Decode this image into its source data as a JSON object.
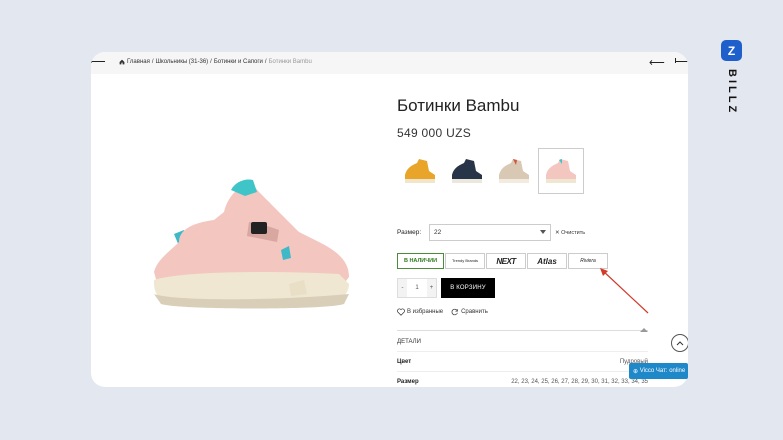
{
  "breadcrumb": {
    "home": "Главная",
    "sep": "/",
    "level1": "Школьникы (31-36)",
    "level2": "Ботинки и Сапоги",
    "current": "Ботинки Bambu"
  },
  "product": {
    "title": "Ботинки Bambu",
    "price": "549 000 UZS"
  },
  "size": {
    "label": "Размер:",
    "value": "22",
    "clear": "Очистить"
  },
  "stores": {
    "in_stock": "В НАЛИЧИИ",
    "logos": [
      "Atlas",
      "Riviera"
    ],
    "logo_next": "NEXT",
    "logo_small": "Trendy Brands"
  },
  "qty": {
    "minus": "-",
    "value": "1",
    "plus": "+"
  },
  "cart_button": "В КОРЗИНУ",
  "actions": {
    "favorites": "В избранные",
    "compare": "Сравнить"
  },
  "details": {
    "heading": "ДЕТАЛИ",
    "rows": [
      {
        "key": "Цвет",
        "value": "Пудровый"
      },
      {
        "key": "Размер",
        "value": "22, 23, 24, 25, 26, 27, 28, 29, 30, 31, 32, 33, 34, 35"
      }
    ]
  },
  "chat": "Vicco Чат: online",
  "brand": {
    "mark": "Z",
    "name": "BILLZ"
  },
  "colors": {
    "accent": "#1f5fcc",
    "instock": "#2d7a1c",
    "arrow": "#d23a2a",
    "chat": "#1e88c8"
  }
}
